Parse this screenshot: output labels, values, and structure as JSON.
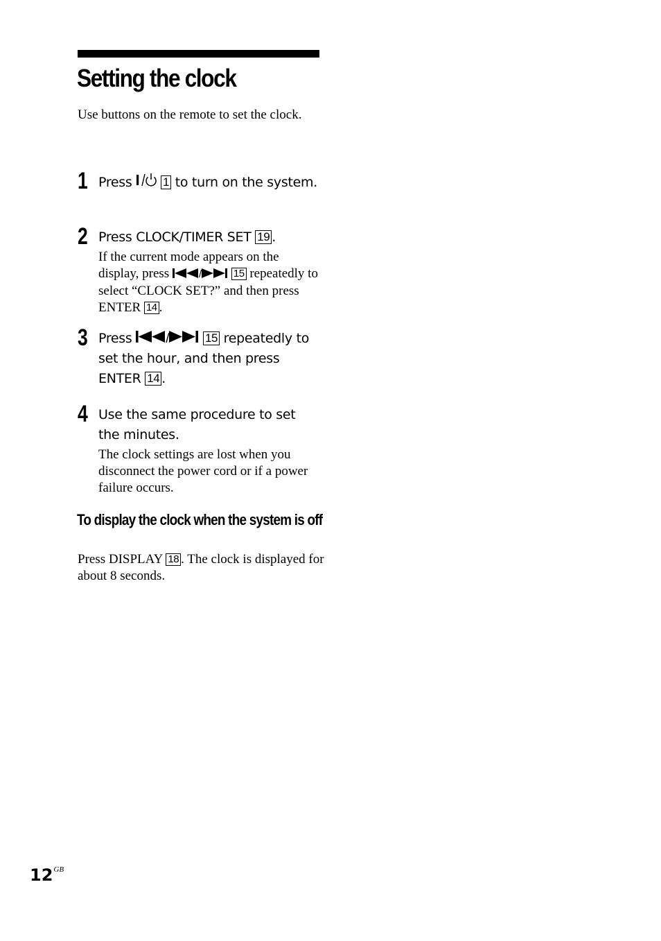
{
  "page": {
    "title": "Setting the clock",
    "intro": "Use buttons on the remote to set the clock.",
    "steps": [
      {
        "number": "1",
        "parts": {
          "a": "Press ",
          "key": "1",
          "b": " to turn on the system."
        },
        "icon": "power-icon"
      },
      {
        "number": "2",
        "parts": {
          "a": "Press CLOCK/TIMER SET ",
          "key": "19",
          "b": "."
        },
        "note": {
          "a": "If the current mode appears on the display, press ",
          "slash": "/",
          "key": "15",
          "b": " repeatedly to select “CLOCK SET?” and then press ENTER ",
          "key2": "14",
          "c": "."
        }
      },
      {
        "number": "3",
        "parts": {
          "a": "Press ",
          "slash": "/",
          "key": "15",
          "b": " repeatedly to set the hour, and then press ENTER ",
          "key2": "14",
          "c": "."
        }
      },
      {
        "number": "4",
        "parts": {
          "a": "Use the same procedure to set the minutes."
        },
        "note": {
          "a": "The clock settings are lost when you disconnect the power cord or if a power failure occurs."
        }
      }
    ],
    "subsection": {
      "heading": "To display the clock when the system is off",
      "text": {
        "a": "Press DISPLAY ",
        "key": "18",
        "b": ". The clock is displayed for about 8 seconds."
      }
    },
    "footer": {
      "page_number": "12",
      "region": "GB"
    }
  }
}
